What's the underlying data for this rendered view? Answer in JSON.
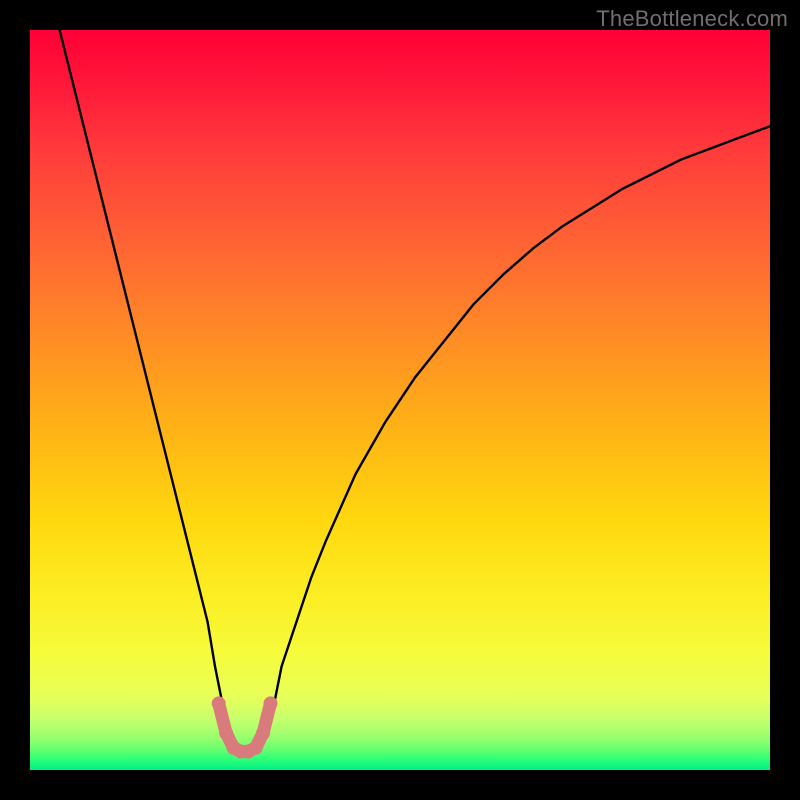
{
  "watermark": "TheBottleneck.com",
  "chart_data": {
    "type": "line",
    "title": "",
    "xlabel": "",
    "ylabel": "",
    "xlim": [
      0,
      100
    ],
    "ylim": [
      0,
      100
    ],
    "grid": false,
    "series": [
      {
        "name": "bottleneck-curve",
        "color": "#000000",
        "x": [
          4,
          6,
          8,
          10,
          12,
          14,
          16,
          18,
          20,
          22,
          24,
          25,
          26,
          27,
          28,
          29,
          30,
          31,
          32,
          33,
          34,
          36,
          38,
          40,
          44,
          48,
          52,
          56,
          60,
          64,
          68,
          72,
          76,
          80,
          84,
          88,
          92,
          96,
          100
        ],
        "y": [
          100,
          92,
          84,
          76,
          68,
          60,
          52,
          44,
          36,
          28,
          20,
          14,
          9,
          5,
          3,
          2.5,
          2.5,
          3,
          5,
          9,
          14,
          20,
          26,
          31,
          40,
          47,
          53,
          58,
          63,
          67,
          70.5,
          73.5,
          76,
          78.5,
          80.5,
          82.5,
          84,
          85.5,
          87
        ]
      },
      {
        "name": "highlight-band",
        "color": "#d97a7d",
        "x": [
          25.5,
          26.5,
          27.5,
          28.5,
          29.5,
          30.5,
          31.5,
          32.5
        ],
        "y": [
          9,
          5,
          3,
          2.5,
          2.5,
          3,
          5,
          9
        ]
      }
    ],
    "gradient_stops": [
      {
        "pos": 0,
        "color": "#ff0036"
      },
      {
        "pos": 50,
        "color": "#ffb914"
      },
      {
        "pos": 85,
        "color": "#f6fb3a"
      },
      {
        "pos": 100,
        "color": "#00ef85"
      }
    ]
  }
}
